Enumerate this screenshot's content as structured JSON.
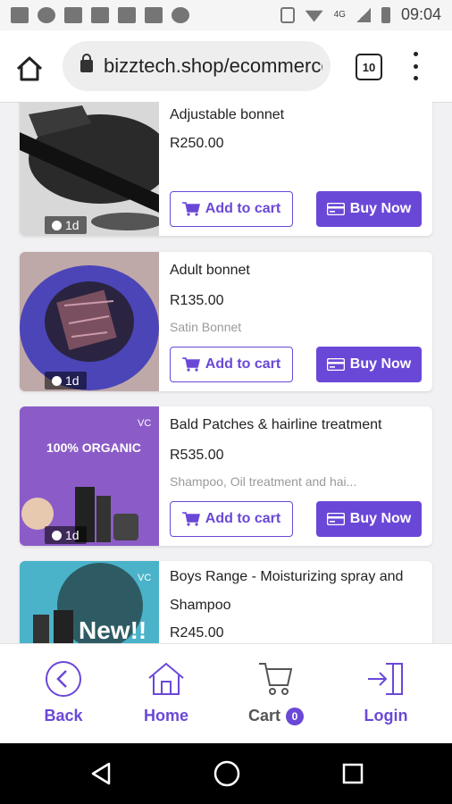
{
  "status_bar": {
    "time": "09:04",
    "network": "4G",
    "icons": [
      "image-icon",
      "cloud-icon",
      "calendar-icon",
      "ge-icon",
      "ge-icon",
      "ge-icon",
      "record-icon",
      "vibrate-icon",
      "wifi-icon",
      "signal-icon",
      "battery-icon"
    ]
  },
  "browser": {
    "url": "bizztech.shop/ecommerce",
    "tab_count": "10"
  },
  "products": [
    {
      "name": "Adjustable bonnet",
      "price": "R250.00",
      "description": "",
      "age": "1d",
      "add_label": "Add to cart",
      "buy_label": "Buy Now"
    },
    {
      "name": "Adult bonnet",
      "price": "R135.00",
      "description": "Satin Bonnet",
      "age": "1d",
      "add_label": "Add to cart",
      "buy_label": "Buy Now"
    },
    {
      "name": "Bald Patches & hairline treatment",
      "price": "R535.00",
      "description": "Shampoo, Oil treatment and hai...",
      "age": "1d",
      "add_label": "Add to cart",
      "buy_label": "Buy Now",
      "image_text": "100% ORGANIC"
    },
    {
      "name": "Boys Range - Moisturizing spray and Shampoo",
      "price": "R245.00",
      "description": "",
      "age": "",
      "image_text": "New!!"
    }
  ],
  "bottom_nav": {
    "back": "Back",
    "home": "Home",
    "cart": "Cart",
    "cart_count": "0",
    "login": "Login"
  },
  "colors": {
    "accent": "#6a48d7"
  }
}
